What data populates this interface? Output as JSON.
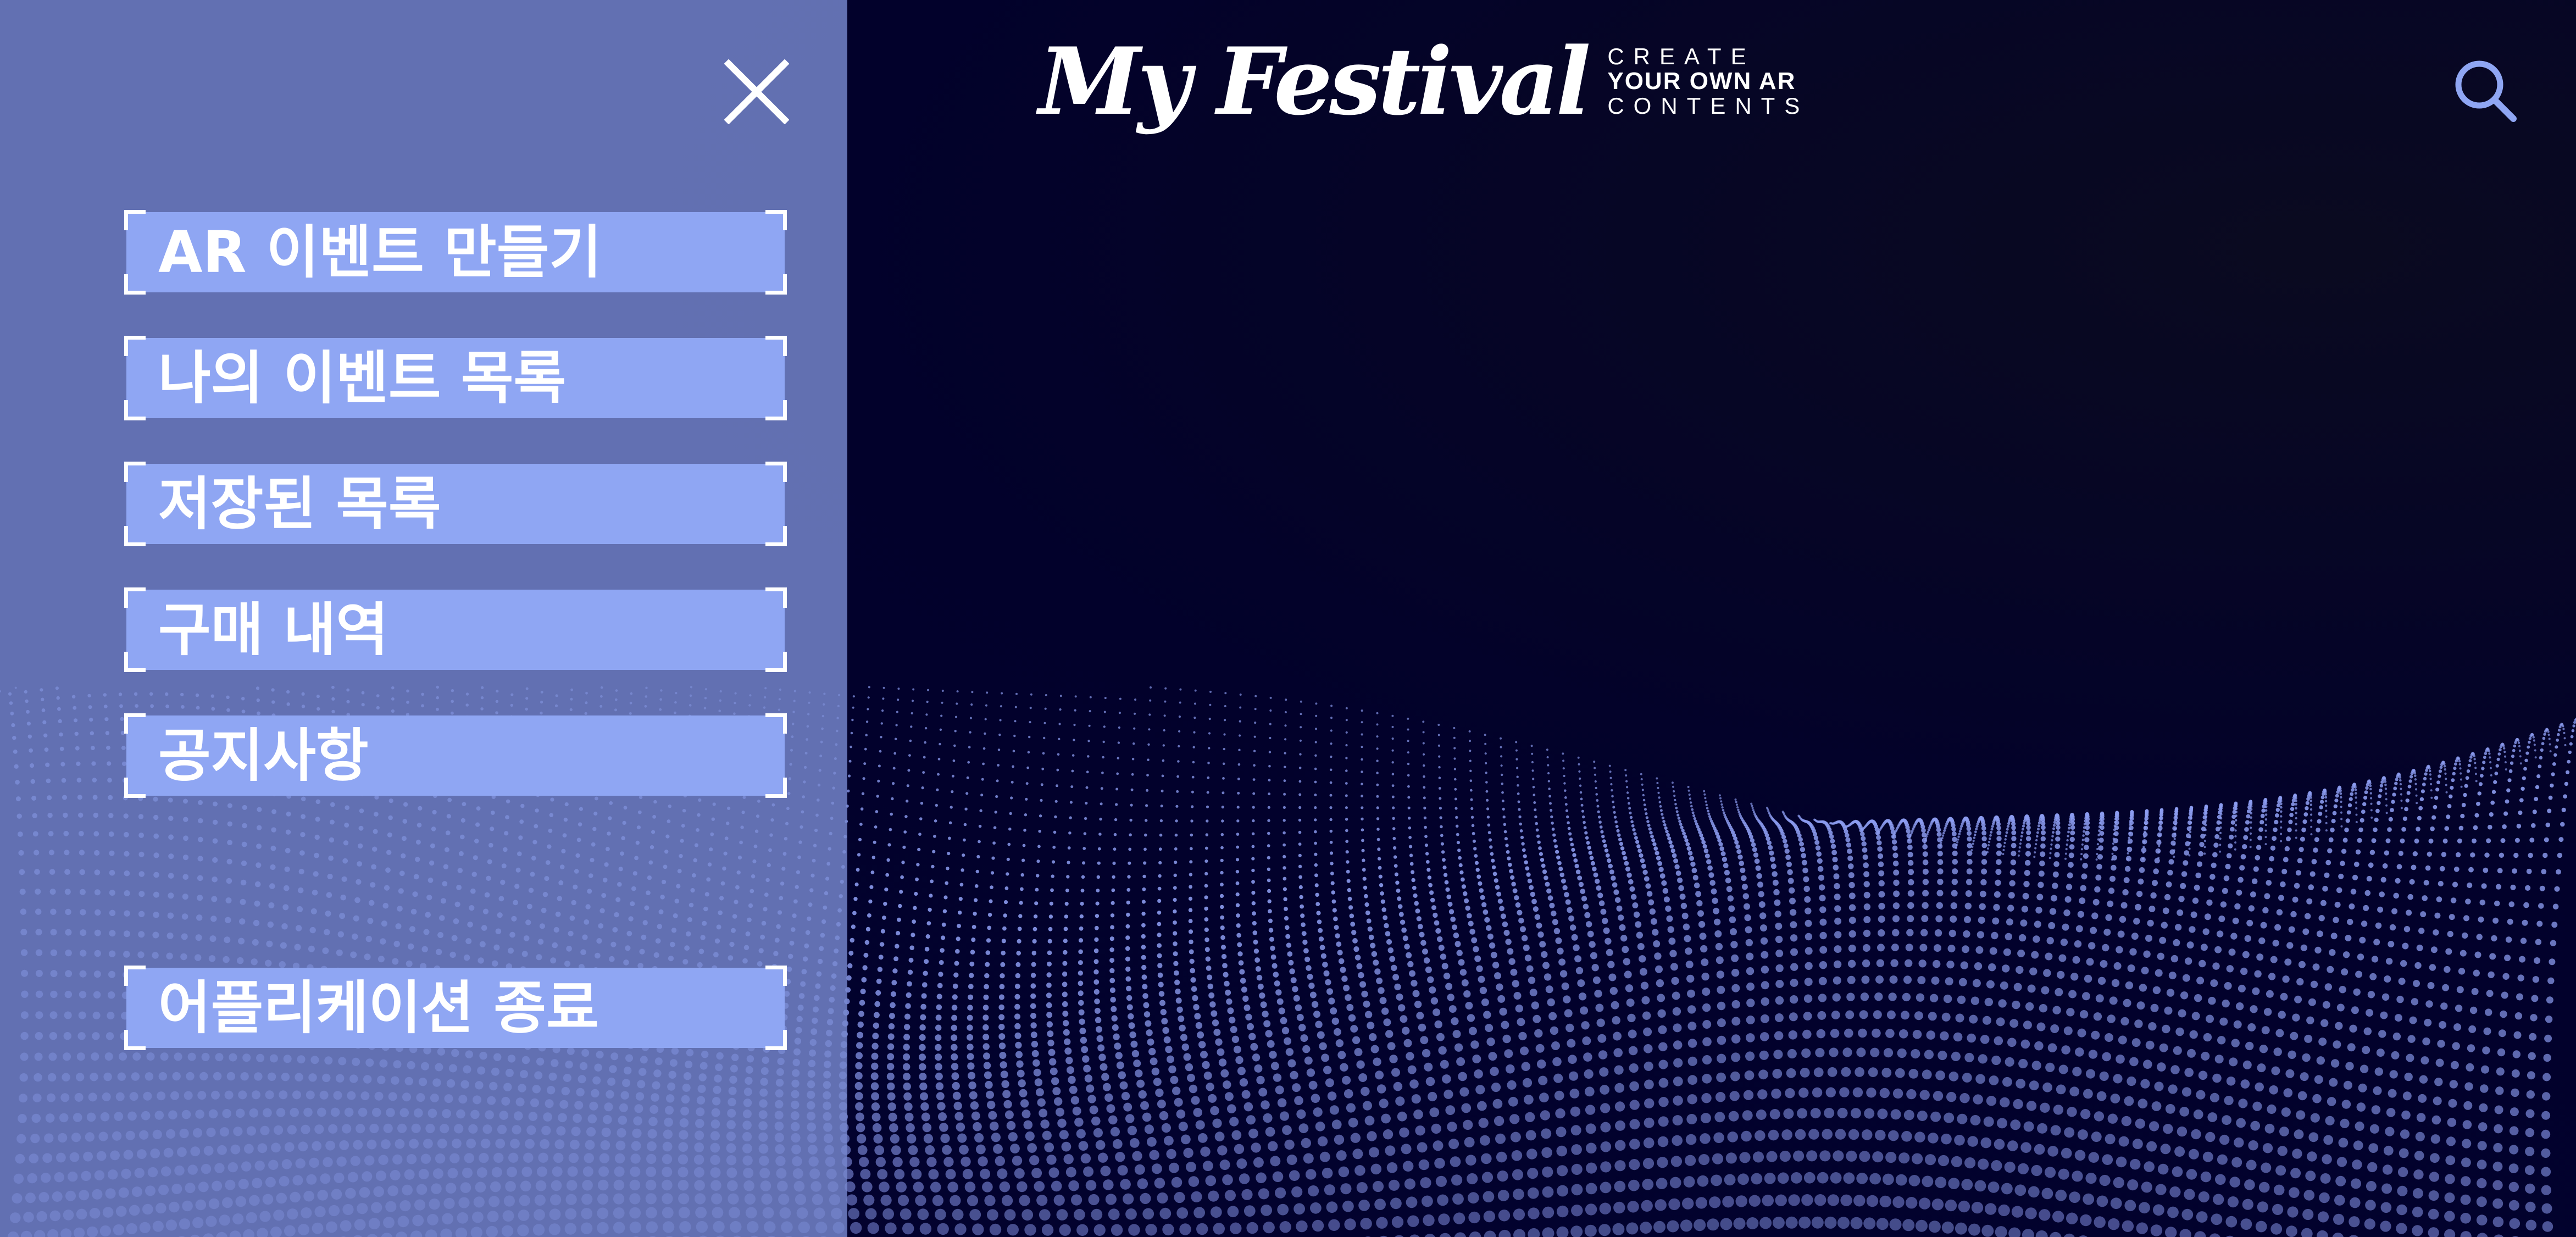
{
  "header": {
    "logo_script": "My Festival",
    "logo_tagline": [
      "CREATE",
      "YOUR OWN AR",
      "CONTENTS"
    ],
    "search_icon": "search-icon"
  },
  "side_menu": {
    "close_icon": "close-icon",
    "items": [
      {
        "label": "AR 이벤트 만들기"
      },
      {
        "label": "나의 이벤트 목록"
      },
      {
        "label": "저장된 목록"
      },
      {
        "label": "구매 내역"
      },
      {
        "label": "공지사항"
      }
    ],
    "exit_item": {
      "label": "어플리케이션 종료"
    }
  },
  "colors": {
    "background": "#02012b",
    "panel": "#7889d0",
    "menu_item_fill": "#8fa6f3",
    "accent": "#8fa6f3",
    "text": "#ffffff",
    "particles": "#8c9cf0"
  }
}
